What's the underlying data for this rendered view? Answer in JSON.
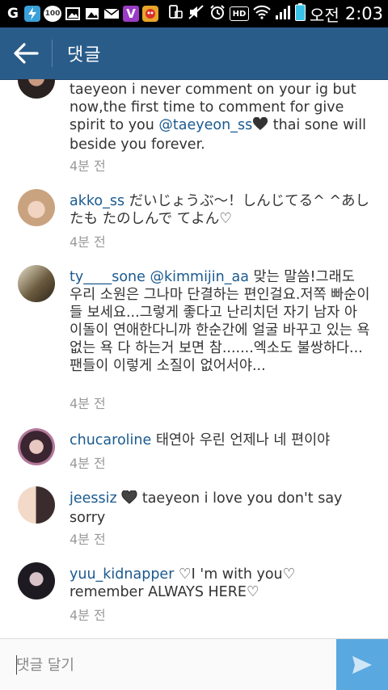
{
  "status_bar": {
    "ampm": "오전",
    "time": "2:03",
    "left_icons": [
      "g-icon",
      "battery-saver-icon",
      "messenger-100-icon",
      "photo-icon",
      "image-icon",
      "mail-icon",
      "v-app-icon",
      "game-icon"
    ],
    "right_icons": [
      "screen-rotate-icon",
      "mute-icon",
      "alarm-icon",
      "hd-icon",
      "wifi-icon",
      "signal-icon",
      "battery-icon"
    ],
    "hd_label": "HD"
  },
  "header": {
    "title": "댓글"
  },
  "comments": [
    {
      "parts": [
        "taeyeon i never comment on your ig but now,the first time to comment for give spirit to you ",
        "@taeyeon_ss",
        " thai sone will beside you forever."
      ],
      "time": "4분 전"
    },
    {
      "username": "akko_ss",
      "text": "だいじょうぶ〜！しんじてる^ ^あしたも たのしんで てよん♡",
      "time": "4분 전"
    },
    {
      "username": "ty____sone",
      "mention": "@kimmijin_aa",
      "text": "맞는 말씀!그래도 우리 소원은 그나마 단결하는 편인걸요.저쪽 빠순이들 보세요...그렇게 좋다고 난리치던 자기 남자 아이돌이 연애한다니까 한순간에 얼굴 바꾸고 있는 욕 없는 욕 다  하는거 보면 참.......엑소도 불쌍하다...팬들이 이렇게 소질이 없어서야...",
      "time": "4분 전"
    },
    {
      "username": "chucaroline",
      "text": "태연아 우린 언제나 네 편이야",
      "time": "4분 전"
    },
    {
      "username": "jeessiz",
      "text": "taeyeon i love you don't say sorry",
      "time": "4분 전"
    },
    {
      "username": "yuu_kidnapper",
      "text": "♡I 'm with you♡ remember ALWAYS HERE♡",
      "time": "4분 전"
    }
  ],
  "input": {
    "placeholder": "댓글 달기"
  },
  "colors": {
    "header_bg": "#2a5c8a",
    "link": "#1b5a8f",
    "send_bg": "#5aa8e0"
  }
}
